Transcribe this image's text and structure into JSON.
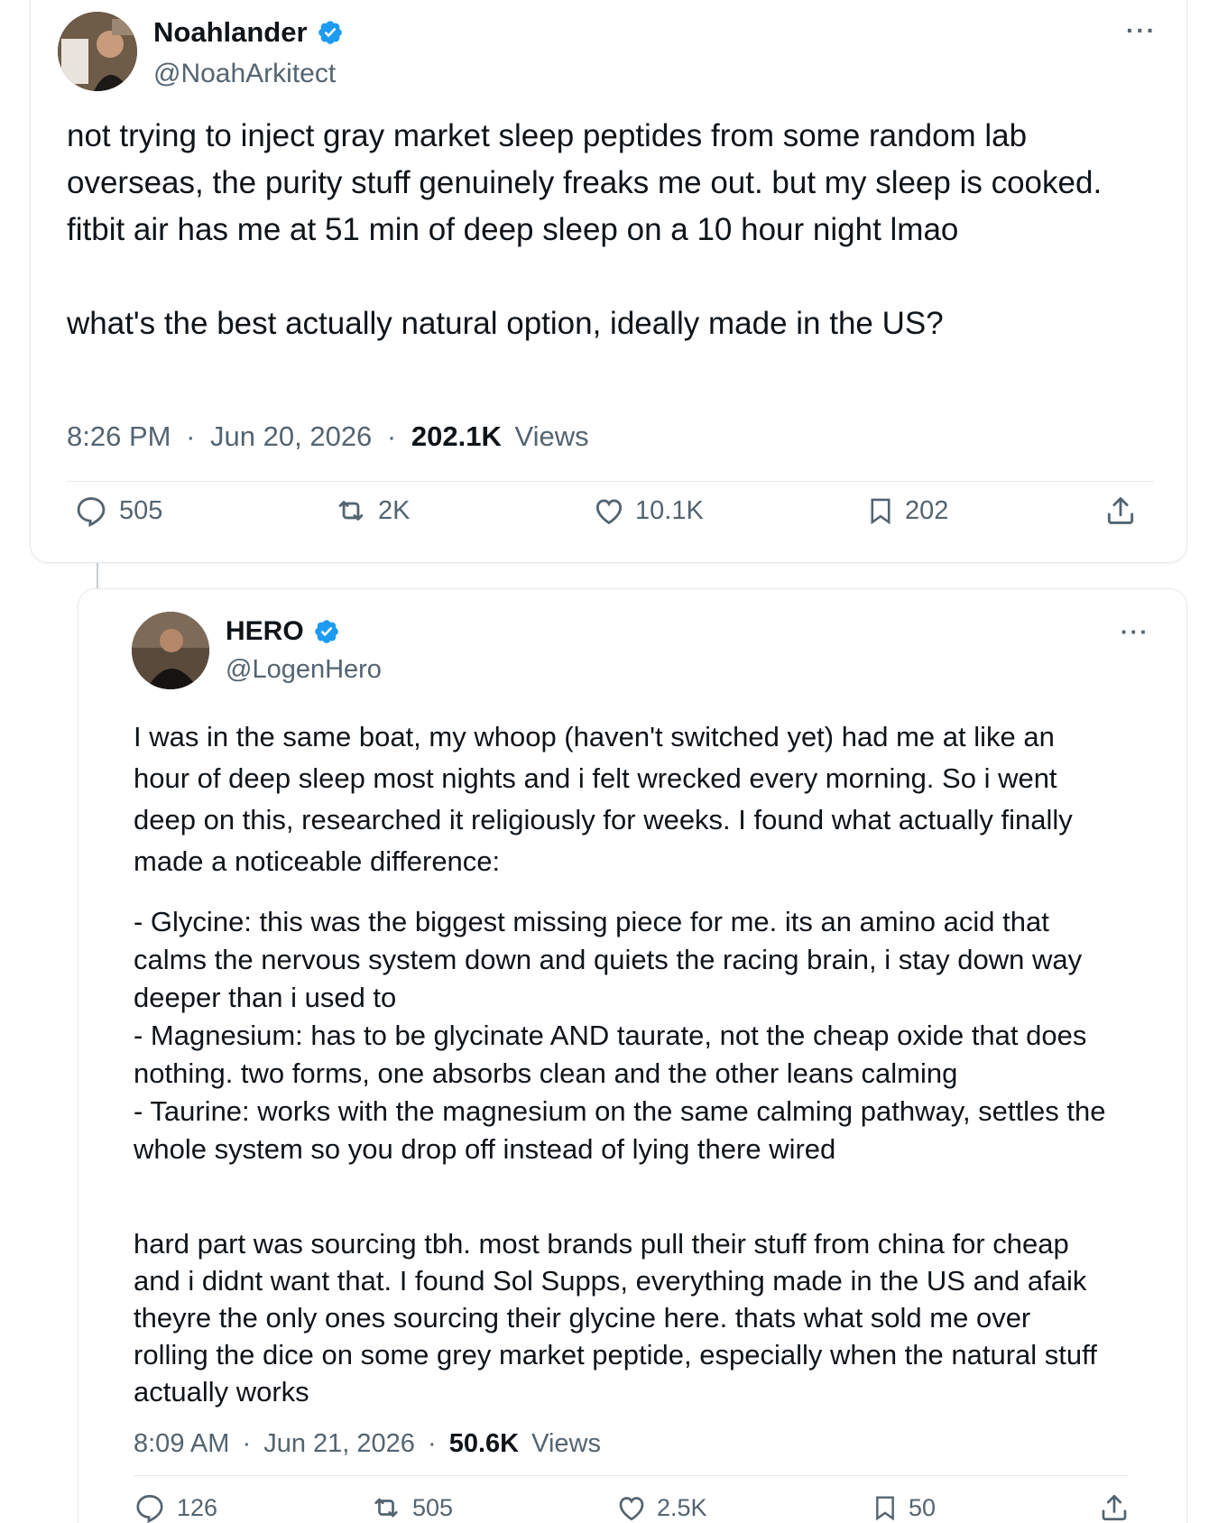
{
  "main_tweet": {
    "display_name": "Noahlander",
    "handle": "@NoahArkitect",
    "more_label": "···",
    "paragraphs": [
      "not trying to inject gray market sleep peptides from some random lab overseas, the purity stuff genuinely freaks me out. but my sleep is cooked. fitbit air has me at 51 min of deep sleep on a 10 hour night lmao",
      "what's the best actually natural option, ideally made in the US?"
    ],
    "time": "8:26 PM",
    "date": "Jun 20, 2026",
    "separator": "·",
    "views_count": "202.1K",
    "views_label": "Views",
    "replies": "505",
    "reposts": "2K",
    "likes": "10.1K",
    "bookmarks": "202"
  },
  "reply_tweet": {
    "display_name": "HERO",
    "handle": "@LogenHero",
    "more_label": "···",
    "paragraph_1": "I was in the same boat, my whoop (haven't switched yet) had me at like an hour of deep sleep most nights and i felt wrecked every morning. So i went deep on this, researched it religiously for weeks. I found what actually finally made a noticeable difference:",
    "list_items": [
      "- Glycine: this was the biggest missing piece for me. its an amino acid that calms the nervous system down and quiets the racing brain, i stay down way deeper than i used to",
      "- Magnesium: has to be glycinate AND taurate, not the cheap oxide that does nothing. two forms, one absorbs clean and the other leans calming",
      "- Taurine: works with the magnesium on the same calming pathway, settles the whole system so you drop off instead of lying there wired"
    ],
    "paragraph_3": "hard part was sourcing tbh. most brands pull their stuff from china for cheap and i didnt want that. I found Sol Supps, everything made in the US and afaik theyre the only ones sourcing their glycine here. thats what sold me over rolling the dice on some grey market peptide, especially when the natural stuff actually works",
    "time": "8:09 AM",
    "date": "Jun 21, 2026",
    "separator": "·",
    "views_count": "50.6K",
    "views_label": "Views",
    "replies": "126",
    "reposts": "505",
    "likes": "2.5K",
    "bookmarks": "50"
  },
  "icons": {
    "verified": "verified-badge-icon",
    "reply": "reply-icon",
    "repost": "repost-icon",
    "like": "heart-icon",
    "bookmark": "bookmark-icon",
    "share": "share-icon"
  },
  "colors": {
    "verified_blue": "#1d9bf0",
    "text_primary": "#0f1419",
    "text_secondary": "#536471",
    "border": "#e6e9ec"
  }
}
